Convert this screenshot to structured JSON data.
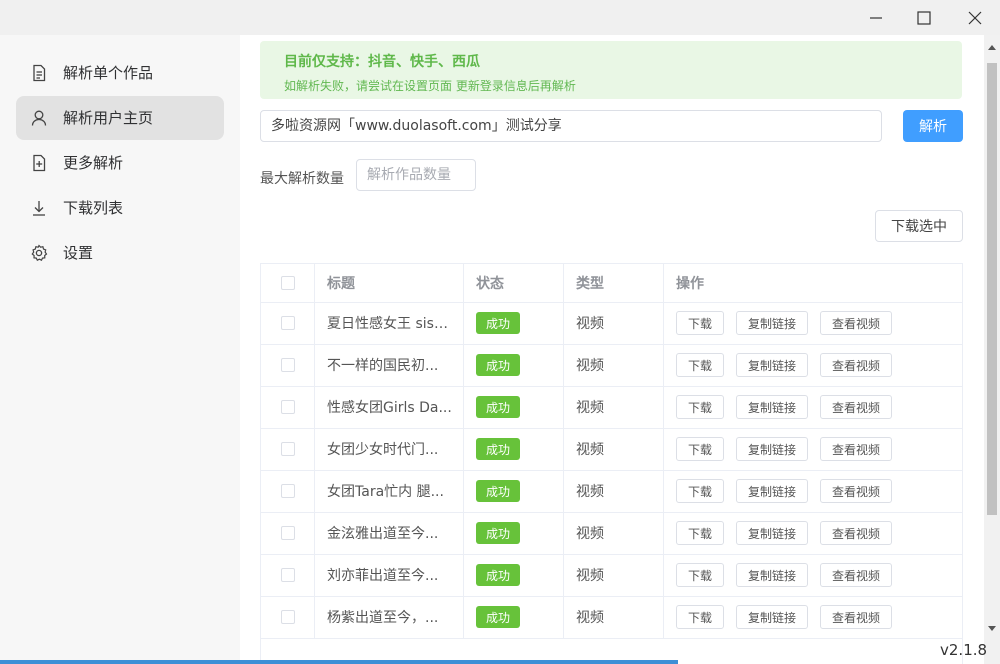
{
  "window": {
    "controls": [
      "minimize",
      "maximize",
      "close"
    ]
  },
  "sidebar": {
    "items": [
      {
        "label": "解析单个作品",
        "icon": "document-icon",
        "active": false
      },
      {
        "label": "解析用户主页",
        "icon": "user-icon",
        "active": true
      },
      {
        "label": "更多解析",
        "icon": "add-file-icon",
        "active": false
      },
      {
        "label": "下载列表",
        "icon": "download-icon",
        "active": false
      },
      {
        "label": "设置",
        "icon": "gear-icon",
        "active": false
      }
    ]
  },
  "notice": {
    "title": "目前仅支持：抖音、快手、西瓜",
    "desc": "如解析失败，请尝试在设置页面 更新登录信息后再解析"
  },
  "url_input": {
    "value": "多啦资源网「www.duolasoft.com」测试分享"
  },
  "parse_button": "解析",
  "max_count": {
    "label": "最大解析数量",
    "placeholder": "解析作品数量"
  },
  "download_selected": "下载选中",
  "table": {
    "headers": [
      "标题",
      "状态",
      "类型",
      "操作"
    ],
    "rows": [
      {
        "title": "夏日性感女王 sist...",
        "status": "成功",
        "type": "视频"
      },
      {
        "title": "不一样的国民初...",
        "status": "成功",
        "type": "视频"
      },
      {
        "title": "性感女团Girls Da...",
        "status": "成功",
        "type": "视频"
      },
      {
        "title": "女团少女时代门...",
        "status": "成功",
        "type": "视频"
      },
      {
        "title": "女团Tara忙内 腿...",
        "status": "成功",
        "type": "视频"
      },
      {
        "title": "金泫雅出道至今...",
        "status": "成功",
        "type": "视频"
      },
      {
        "title": "刘亦菲出道至今...",
        "status": "成功",
        "type": "视频"
      },
      {
        "title": "杨紫出道至今，...",
        "status": "成功",
        "type": "视频"
      }
    ],
    "row_actions": [
      "下载",
      "复制链接",
      "查看视频"
    ]
  },
  "colors": {
    "primary": "#409eff",
    "success": "#67c23a",
    "notice_bg": "#e9f7e5",
    "notice_text": "#5fb84a"
  },
  "version": "v2.1.8"
}
